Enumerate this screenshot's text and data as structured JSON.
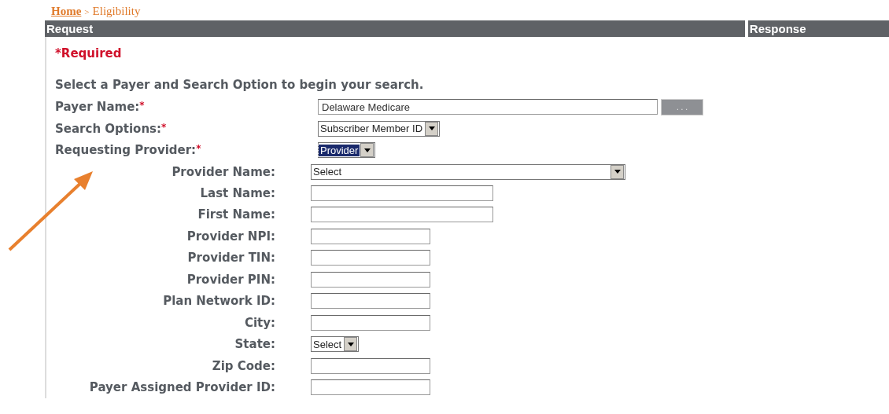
{
  "breadcrumb": {
    "home": "Home",
    "separator": ">",
    "current": "Eligibility"
  },
  "request": {
    "title": "Request",
    "required_note": "*Required",
    "instruction": "Select a Payer and Search Option to begin your search.",
    "fields": [
      {
        "label": "Payer Name:",
        "required_mark": "*",
        "kind": "lookup",
        "value": "Delaware Medicare",
        "button": ". . ."
      },
      {
        "label": "Search Options:",
        "required_mark": "*",
        "kind": "select",
        "value": "Subscriber Member ID",
        "focused": false
      },
      {
        "label": "Requesting Provider:",
        "required_mark": "*",
        "kind": "select",
        "value": "Provider",
        "focused": true,
        "children": [
          {
            "label": "Provider Name:",
            "kind": "wide-select",
            "value": "Select"
          },
          {
            "label": "Last Name:",
            "kind": "wide-text"
          },
          {
            "label": "First Name:",
            "kind": "wide-text"
          },
          {
            "label": "Provider NPI:",
            "kind": "text"
          },
          {
            "label": "Provider TIN:",
            "kind": "text"
          },
          {
            "label": "Provider PIN:",
            "kind": "text"
          },
          {
            "label": "Plan Network ID:",
            "kind": "text"
          },
          {
            "label": "City:",
            "kind": "text"
          },
          {
            "label": "State:",
            "kind": "select",
            "value": "Select",
            "focused": false
          },
          {
            "label": "Zip Code:",
            "kind": "text"
          },
          {
            "label": "Payer Assigned Provider ID:",
            "kind": "text"
          }
        ]
      }
    ]
  },
  "response": {
    "title": "Response"
  }
}
